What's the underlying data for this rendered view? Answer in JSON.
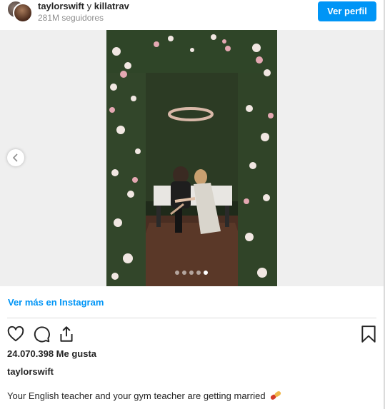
{
  "header": {
    "user1": "taylorswift",
    "conjunction": "y",
    "user2": "killatrav",
    "followers": "281M seguidores",
    "profile_button": "Ver perfil"
  },
  "media": {
    "carousel_total": 5,
    "carousel_active": 5
  },
  "view_more": "Ver más en Instagram",
  "likes": "24.070.398 Me gusta",
  "owner": "taylorswift",
  "caption": "Your English teacher and your gym teacher are getting married",
  "colors": {
    "accent": "#0095f6",
    "text": "#262626",
    "muted": "#8e8e8e"
  }
}
